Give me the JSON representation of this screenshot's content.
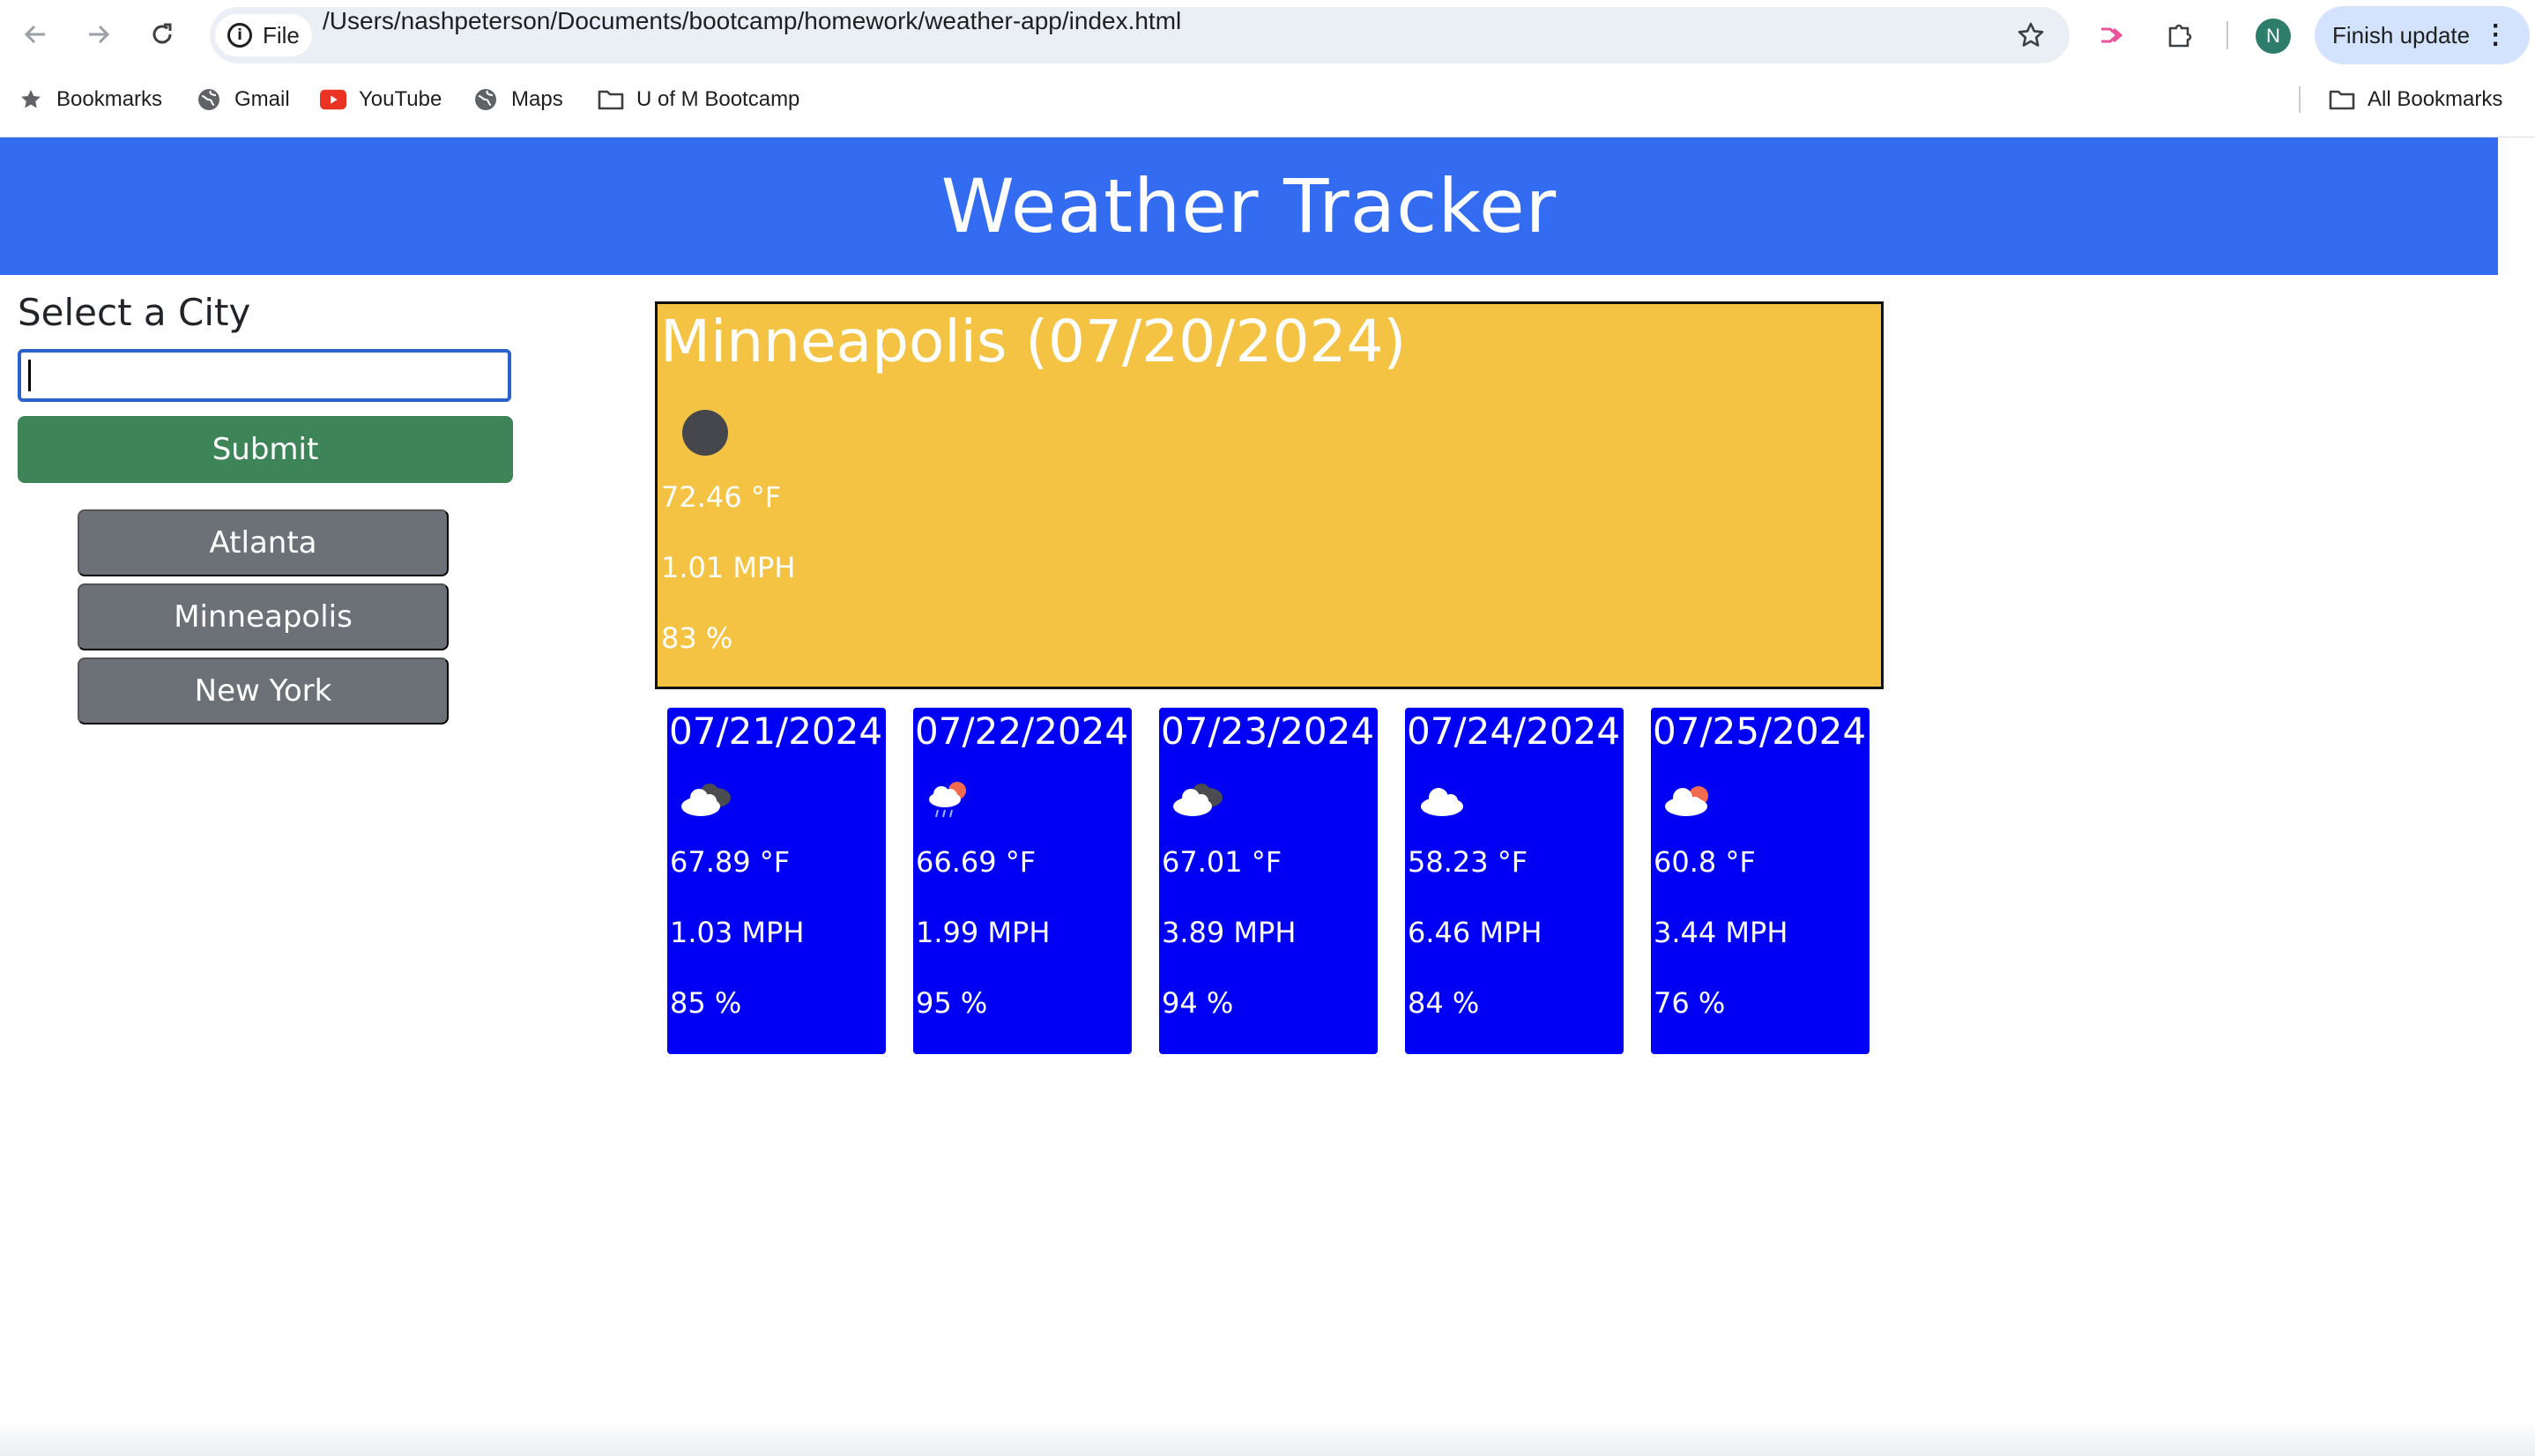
{
  "browser": {
    "file_label": "File",
    "url": "/Users/nashpeterson/Documents/bootcamp/homework/weather-app/index.html",
    "avatar_letter": "N",
    "finish_update_label": "Finish update",
    "bookmarks": [
      {
        "label": "Bookmarks",
        "icon": "star-icon"
      },
      {
        "label": "Gmail",
        "icon": "globe-icon"
      },
      {
        "label": "YouTube",
        "icon": "youtube-icon"
      },
      {
        "label": "Maps",
        "icon": "globe-icon"
      },
      {
        "label": "U of M Bootcamp",
        "icon": "folder-icon"
      }
    ],
    "all_bookmarks_label": "All Bookmarks"
  },
  "header": {
    "title": "Weather Tracker"
  },
  "sidebar": {
    "heading": "Select a City",
    "input_value": "",
    "submit_label": "Submit",
    "history": [
      "Atlanta",
      "Minneapolis",
      "New York"
    ]
  },
  "current": {
    "title": "Minneapolis (07/20/2024)",
    "icon": "dark-circle-icon",
    "temp": "72.46 °F",
    "wind": "1.01 MPH",
    "humidity": "83 %"
  },
  "forecast": [
    {
      "date": "07/21/2024",
      "icon": "dark-cloud-icon",
      "temp": "67.89 °F",
      "wind": "1.03 MPH",
      "humidity": "85 %"
    },
    {
      "date": "07/22/2024",
      "icon": "rain-sun-cloud-icon",
      "temp": "66.69 °F",
      "wind": "1.99 MPH",
      "humidity": "95 %"
    },
    {
      "date": "07/23/2024",
      "icon": "dark-cloud-icon",
      "temp": "67.01 °F",
      "wind": "3.89 MPH",
      "humidity": "94 %"
    },
    {
      "date": "07/24/2024",
      "icon": "cloud-icon",
      "temp": "58.23 °F",
      "wind": "6.46 MPH",
      "humidity": "84 %"
    },
    {
      "date": "07/25/2024",
      "icon": "sun-cloud-icon",
      "temp": "60.8 °F",
      "wind": "3.44 MPH",
      "humidity": "76 %"
    }
  ],
  "colors": {
    "header_bg": "#336cf0",
    "submit_bg": "#3d8558",
    "history_bg": "#6c7178",
    "current_bg": "#f4c343",
    "forecast_bg": "#0000f5"
  }
}
